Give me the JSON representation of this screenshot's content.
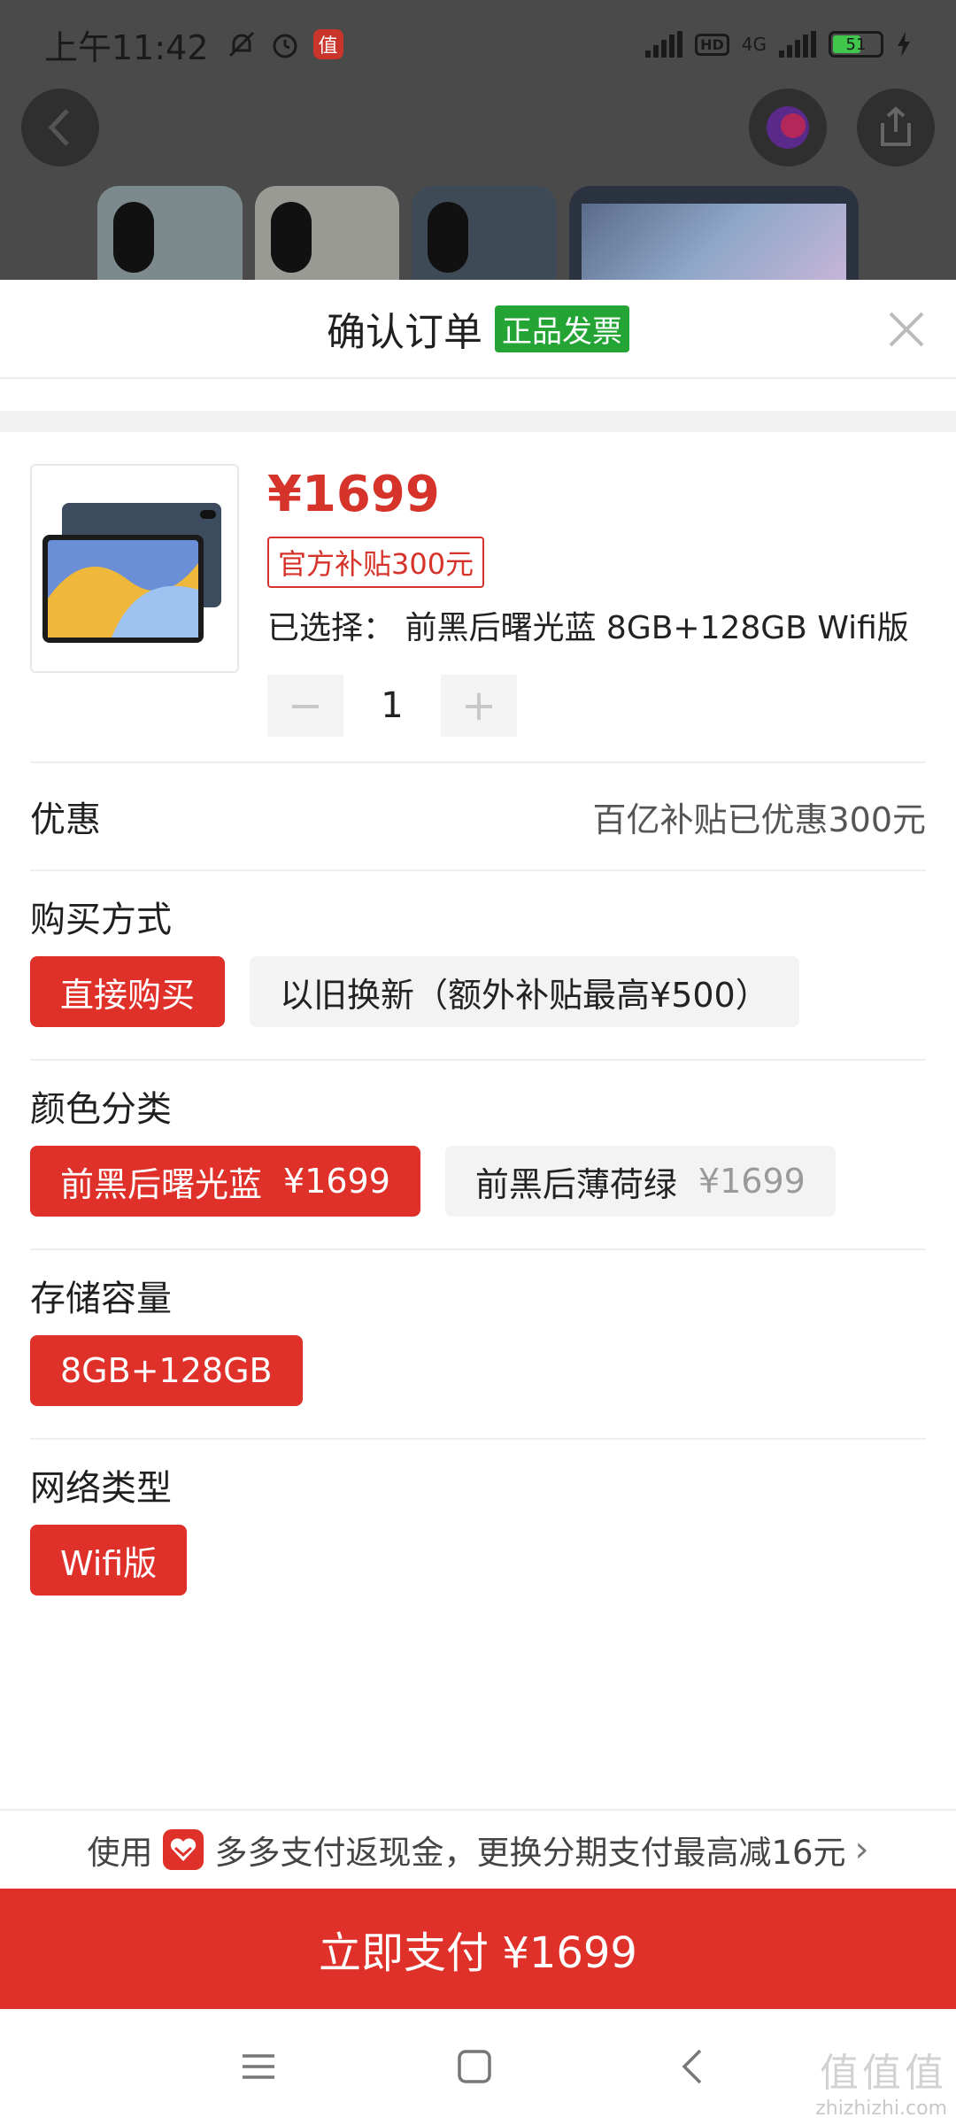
{
  "status_bar": {
    "time": "上午11:42",
    "app_icon_glyph": "值",
    "network": "4G",
    "hd": "HD",
    "battery": "51"
  },
  "sheet": {
    "title": "确认订单",
    "invoice_badge": "正品发票"
  },
  "product": {
    "price": "¥1699",
    "subsidy_tag": "官方补贴300元",
    "selected_label": "已选择：",
    "selected_value": "前黑后曙光蓝 8GB+128GB Wifi版",
    "quantity": "1",
    "minus": "−",
    "plus": "+"
  },
  "discount": {
    "label": "优惠",
    "value": "百亿补贴已优惠300元"
  },
  "purchase_method": {
    "title": "购买方式",
    "options": [
      {
        "label": "直接购买"
      },
      {
        "label": "以旧换新（额外补贴最高¥500）"
      }
    ]
  },
  "color": {
    "title": "颜色分类",
    "options": [
      {
        "label": "前黑后曙光蓝",
        "price": "¥1699"
      },
      {
        "label": "前黑后薄荷绿",
        "price": "¥1699"
      }
    ]
  },
  "storage": {
    "title": "存储容量",
    "options": [
      {
        "label": "8GB+128GB"
      }
    ]
  },
  "network_type": {
    "title": "网络类型",
    "options": [
      {
        "label": "Wifi版"
      }
    ]
  },
  "promo": {
    "prefix": "使用",
    "text": "多多支付返现金，更换分期支付最高减16元",
    "arrow": "›"
  },
  "pay_button": "立即支付 ¥1699",
  "watermark": {
    "big": "值值值",
    "small": "zhizhizhi.com"
  },
  "colors": {
    "accent_red": "#e0302a",
    "price_red": "#d6332b",
    "badge_green": "#23a435"
  },
  "icons": [
    "back-icon",
    "share-icon",
    "close-icon",
    "heart-icon",
    "menu-icon",
    "home-icon",
    "nav-back-icon"
  ]
}
